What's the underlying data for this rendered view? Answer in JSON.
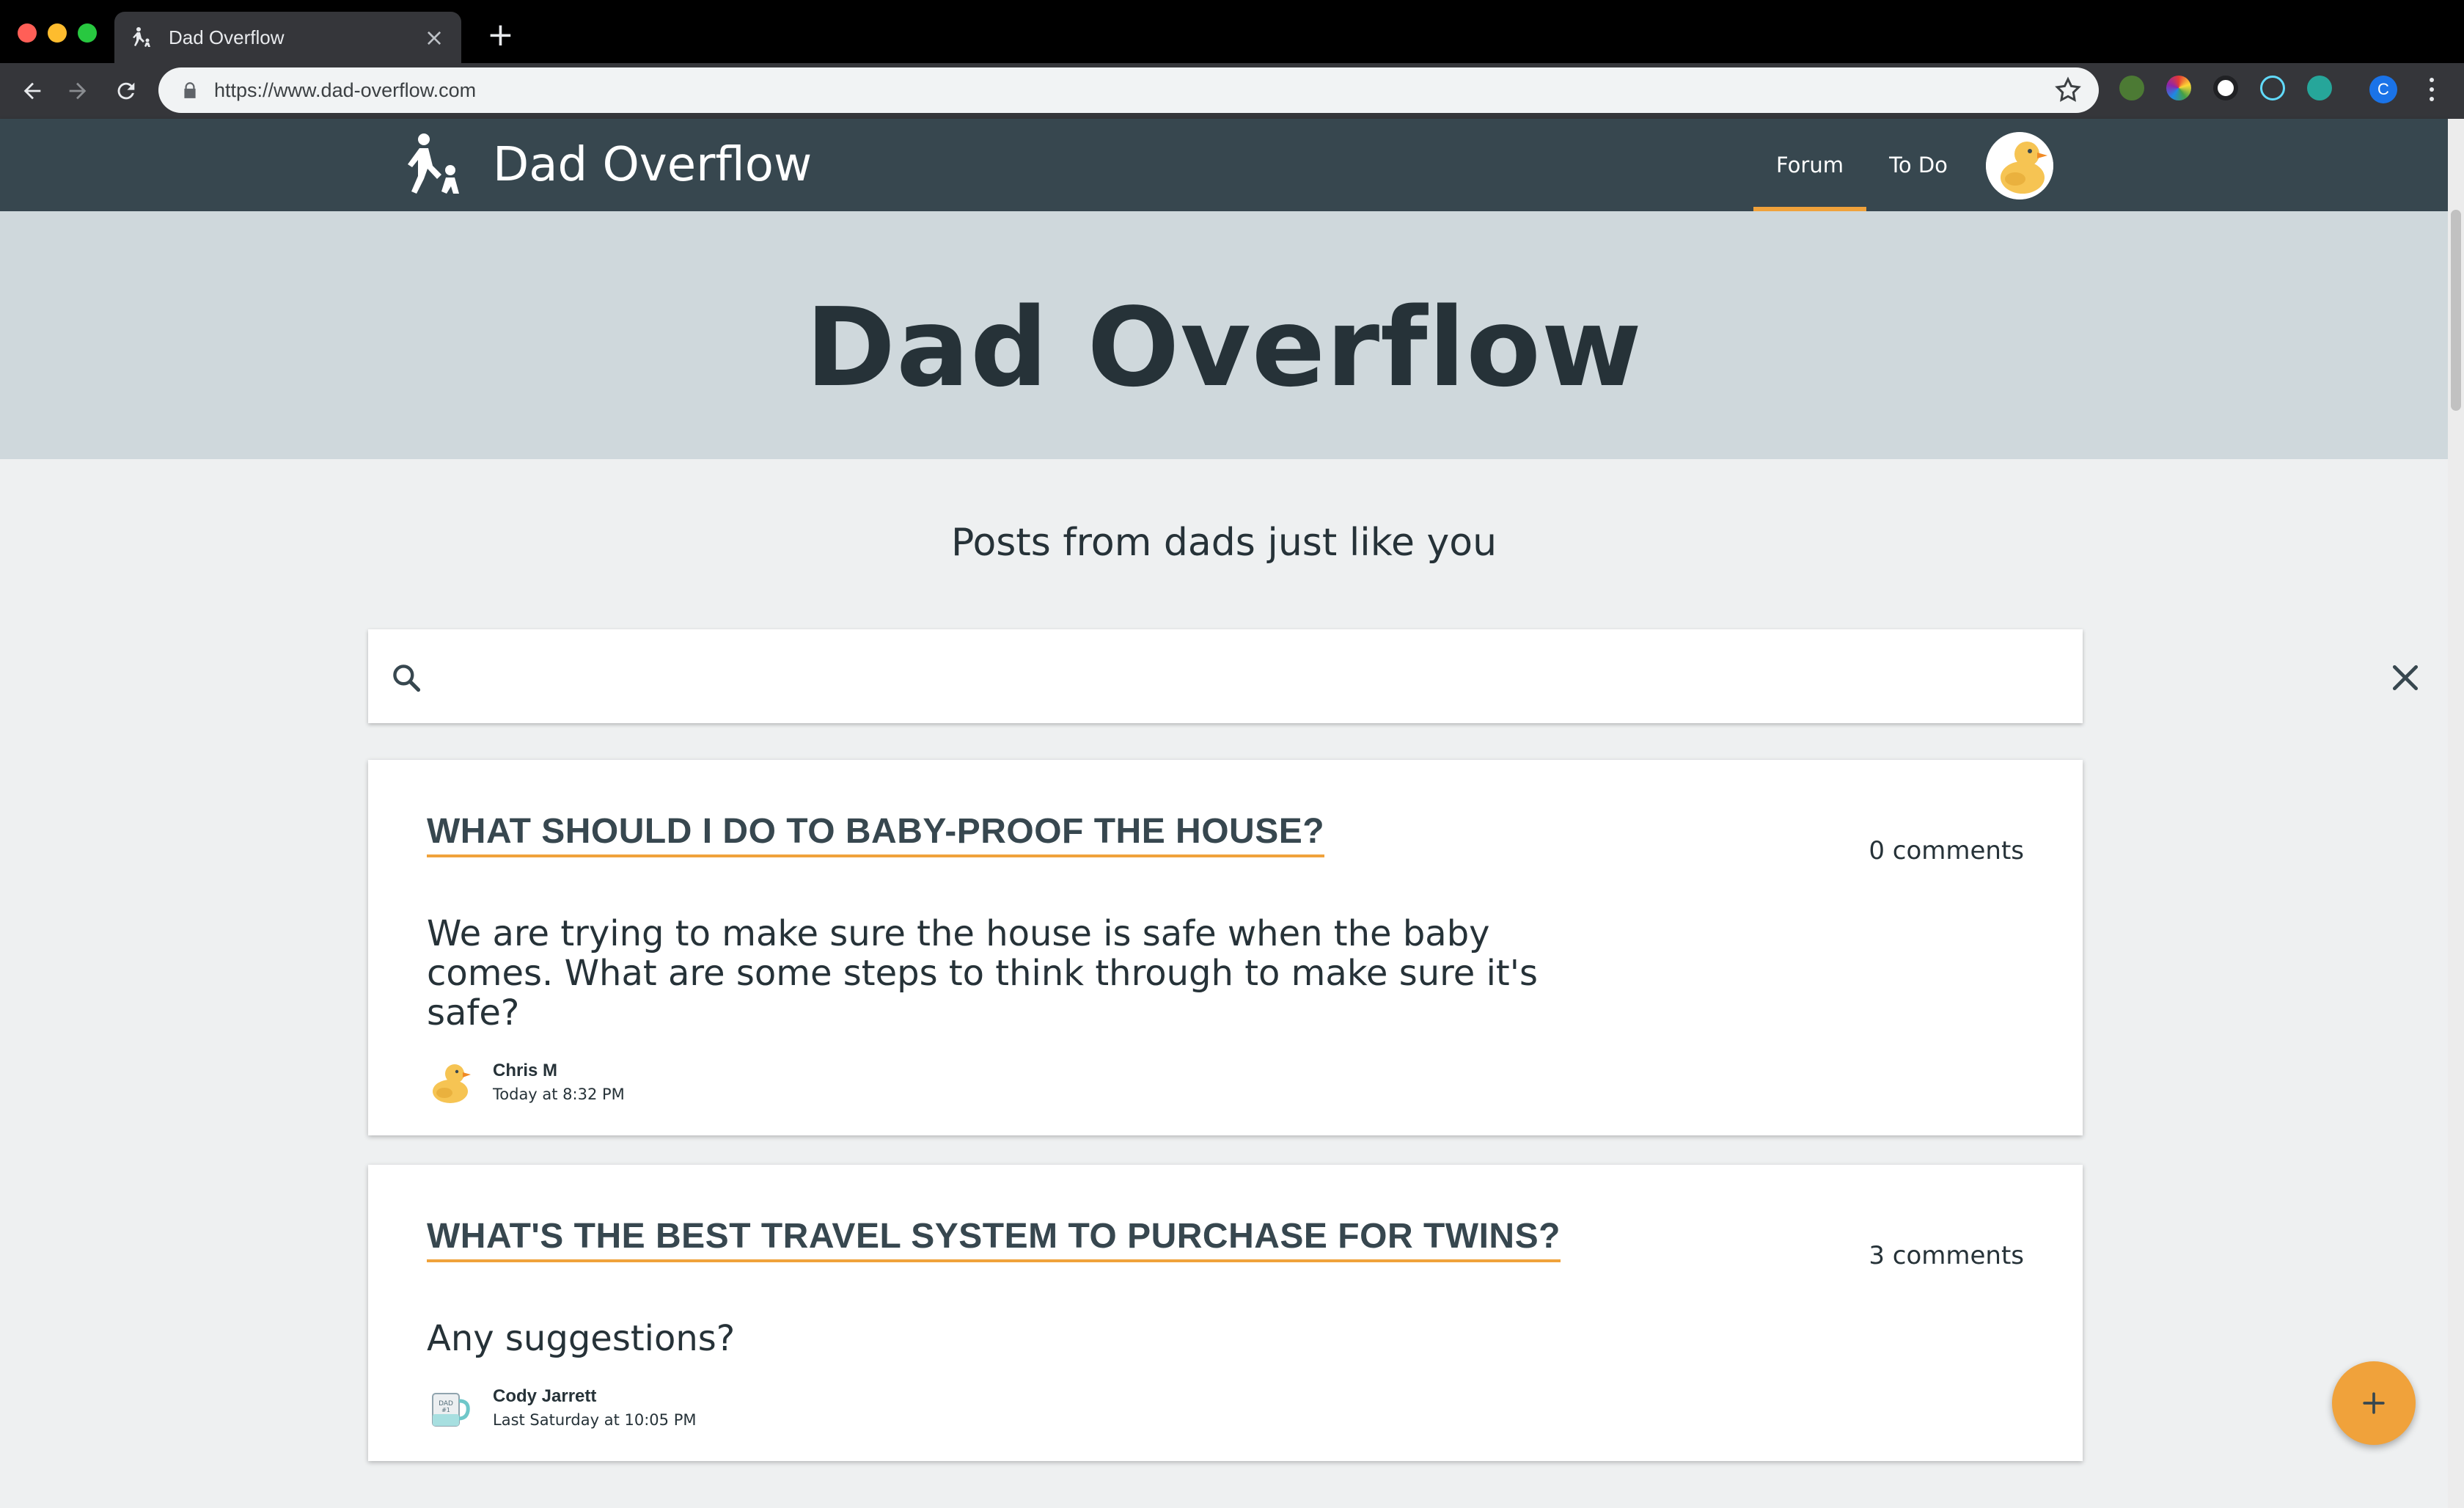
{
  "browser": {
    "tab_title": "Dad Overflow",
    "url": "https://www.dad-overflow.com",
    "profile_initial": "C"
  },
  "app": {
    "brand_name": "Dad Overflow",
    "nav": [
      {
        "label": "Forum",
        "active": true
      },
      {
        "label": "To Do",
        "active": false
      }
    ]
  },
  "hero": {
    "title": "Dad Overflow"
  },
  "main": {
    "subtitle": "Posts from dads just like you",
    "search": {
      "placeholder": "",
      "value": ""
    }
  },
  "posts": [
    {
      "title": "WHAT SHOULD I DO TO BABY-PROOF THE HOUSE?",
      "comments": "0 comments",
      "body": "We are trying to make sure the house is safe when the baby comes. What are some steps to think through to make sure it's safe?",
      "author": "Chris M",
      "date": "Today at 8:32 PM",
      "avatar": "duck-icon"
    },
    {
      "title": "WHAT'S THE BEST TRAVEL SYSTEM TO PURCHASE FOR TWINS?",
      "comments": "3 comments",
      "body": "Any suggestions?",
      "author": "Cody Jarrett",
      "date": "Last Saturday at 10:05 PM",
      "avatar": "mug-icon"
    }
  ],
  "colors": {
    "header": "#37474f",
    "hero": "#cfd8dc",
    "accent": "#f0a23b",
    "text": "#263238",
    "background": "#eef0f1"
  }
}
